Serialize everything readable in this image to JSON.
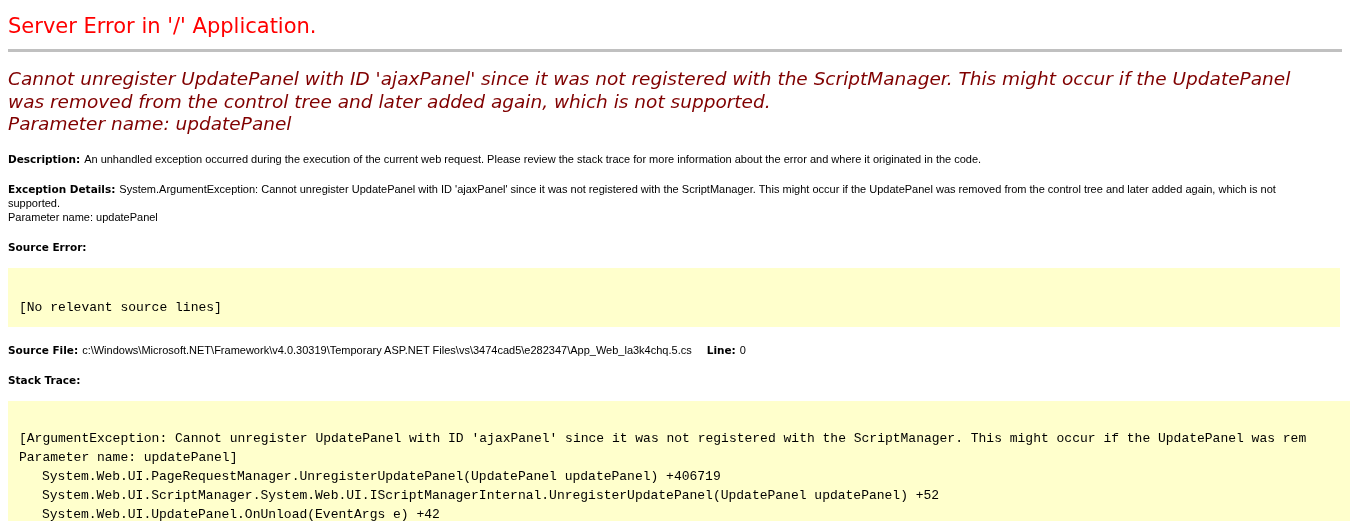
{
  "title": "Server Error in '/' Application.",
  "heading": {
    "message": "Cannot unregister UpdatePanel with ID 'ajaxPanel' since it was not registered with the ScriptManager. This might occur if the UpdatePanel was removed from the control tree and later added again, which is not supported.",
    "parameter": "Parameter name: updatePanel"
  },
  "description": {
    "label": "Description:",
    "text": "An unhandled exception occurred during the execution of the current web request. Please review the stack trace for more information about the error and where it originated in the code."
  },
  "exception_details": {
    "label": "Exception Details:",
    "text": "System.ArgumentException: Cannot unregister UpdatePanel with ID 'ajaxPanel' since it was not registered with the ScriptManager. This might occur if the UpdatePanel was removed from the control tree and later added again, which is not supported.",
    "parameter": "Parameter name: updatePanel"
  },
  "source_error": {
    "label": "Source Error:",
    "lines": [
      "[No relevant source lines]"
    ]
  },
  "source_file": {
    "label": "Source File:",
    "path": "c:\\Windows\\Microsoft.NET\\Framework\\v4.0.30319\\Temporary ASP.NET Files\\vs\\3474cad5\\e282347\\App_Web_la3k4chq.5.cs",
    "line_label": "Line:",
    "line": "0"
  },
  "stack_trace": {
    "label": "Stack Trace:",
    "lines": [
      {
        "kind": "message",
        "text": "[ArgumentException: Cannot unregister UpdatePanel with ID 'ajaxPanel' since it was not registered with the ScriptManager. This might occur if the UpdatePanel was rem"
      },
      {
        "kind": "message",
        "text": "Parameter name: updatePanel]"
      },
      {
        "kind": "frame",
        "text": "System.Web.UI.PageRequestManager.UnregisterUpdatePanel(UpdatePanel updatePanel) +406719"
      },
      {
        "kind": "frame",
        "text": "System.Web.UI.ScriptManager.System.Web.UI.IScriptManagerInternal.UnregisterUpdatePanel(UpdatePanel updatePanel) +52"
      },
      {
        "kind": "frame",
        "text": "System.Web.UI.UpdatePanel.OnUnload(EventArgs e) +42"
      }
    ]
  }
}
